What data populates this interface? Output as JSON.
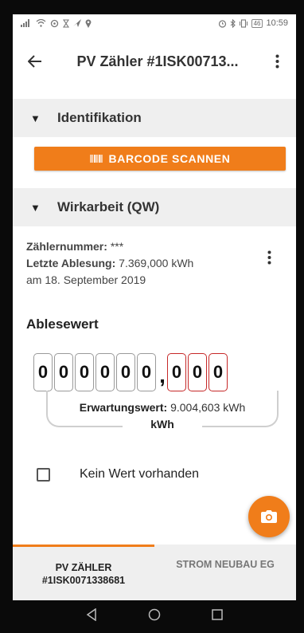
{
  "statusbar": {
    "time": "10:59",
    "battery": "46",
    "left_icons": "signal wifi sync hourglass send location"
  },
  "appbar": {
    "title": "PV Zähler #1ISK00713...",
    "back_icon": "arrow-left-icon",
    "more_icon": "overflow-menu-icon"
  },
  "sections": {
    "identifikation": "Identifikation",
    "wirkarbeit": "Wirkarbeit (QW)"
  },
  "barcode_button": "BARCODE SCANNEN",
  "meter": {
    "zaehlernummer_label": "Zählernummer:",
    "zaehlernummer_value": "***",
    "letzte_label": "Letzte Ablesung:",
    "letzte_value": "7.369,000 kWh",
    "date": "am 18. September 2019"
  },
  "reading": {
    "title": "Ablesewert",
    "integer_digits": [
      "0",
      "0",
      "0",
      "0",
      "0",
      "0"
    ],
    "decimal_separator": ",",
    "decimal_digits": [
      "0",
      "0",
      "0"
    ],
    "erwartung_label": "Erwartungswert:",
    "erwartung_value": "9.004,603 kWh",
    "unit": "kWh"
  },
  "kein_wert": {
    "label": "Kein Wert vorhanden",
    "checked": false
  },
  "fab_icon": "camera-icon",
  "tabs": [
    {
      "label": "PV ZÄHLER\n#1ISK0071338681",
      "active": true
    },
    {
      "label": "STROM NEUBAU EG",
      "active": false
    }
  ],
  "colors": {
    "accent": "#f07d1a",
    "decimal_border": "#c62828",
    "section_bg": "#efefef"
  }
}
